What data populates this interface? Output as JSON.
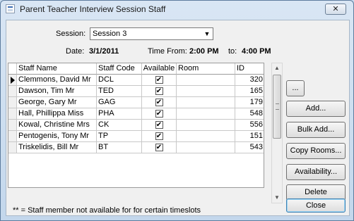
{
  "window": {
    "title": "Parent Teacher Interview Session Staff",
    "close_glyph": "✕"
  },
  "session": {
    "label": "Session:",
    "value": "Session 3"
  },
  "info": {
    "date_label": "Date:",
    "date_value": "3/1/2011",
    "time_from_label": "Time From:",
    "time_from_value": "2:00 PM",
    "to_label": "to:",
    "to_value": "4:00 PM"
  },
  "grid": {
    "columns": [
      "Staff Name",
      "Staff Code",
      "Available",
      "Room",
      "ID"
    ],
    "rows": [
      {
        "name": "Clemmons, David Mr",
        "code": "DCL",
        "available": "✔",
        "room": "",
        "id": "320"
      },
      {
        "name": "Dawson, Tim Mr",
        "code": "TED",
        "available": "✔",
        "room": "",
        "id": "165"
      },
      {
        "name": "George, Gary Mr",
        "code": "GAG",
        "available": "✔",
        "room": "",
        "id": "179"
      },
      {
        "name": "Hall, Phillippa Miss",
        "code": "PHA",
        "available": "✔",
        "room": "",
        "id": "548"
      },
      {
        "name": "Kowal, Christine Mrs",
        "code": "CK",
        "available": "✔",
        "room": "",
        "id": "556"
      },
      {
        "name": "Pentogenis, Tony Mr",
        "code": "TP",
        "available": "✔",
        "room": "",
        "id": "151"
      },
      {
        "name": "Triskelidis, Bill Mr",
        "code": "BT",
        "available": "✔",
        "room": "",
        "id": "543"
      }
    ]
  },
  "buttons": {
    "ellipsis": "...",
    "add": "Add...",
    "bulk_add": "Bulk Add...",
    "copy_rooms": "Copy Rooms...",
    "availability": "Availability...",
    "delete": "Delete",
    "close": "Close"
  },
  "footnote": "** = Staff member not available for for certain timeslots"
}
